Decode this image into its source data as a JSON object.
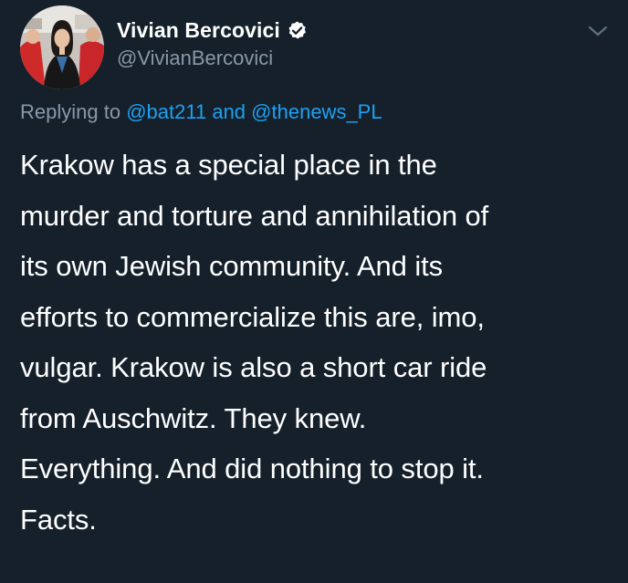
{
  "tweet": {
    "display_name": "Vivian Bercovici",
    "handle": "@VivianBercovici",
    "verified": true,
    "replying_prefix": "Replying to",
    "mention_1": "@bat211",
    "replying_joiner": "and",
    "mention_2": "@thenews_PL",
    "lines": [
      "Krakow has a special place in the",
      "murder and torture and annihilation of",
      "its own Jewish community. And its",
      "efforts to commercialize this are, imo,",
      "vulgar. Krakow is also a short car ride",
      "from Auschwitz. They knew.",
      "Everything. And did nothing to stop it.",
      "Facts."
    ]
  },
  "icons": {
    "verified": "verified-badge-icon",
    "menu": "chevron-down-icon"
  },
  "colors": {
    "background": "#15202b",
    "text": "#ffffff",
    "secondary_text": "#8899a6",
    "link": "#1da1f2"
  }
}
